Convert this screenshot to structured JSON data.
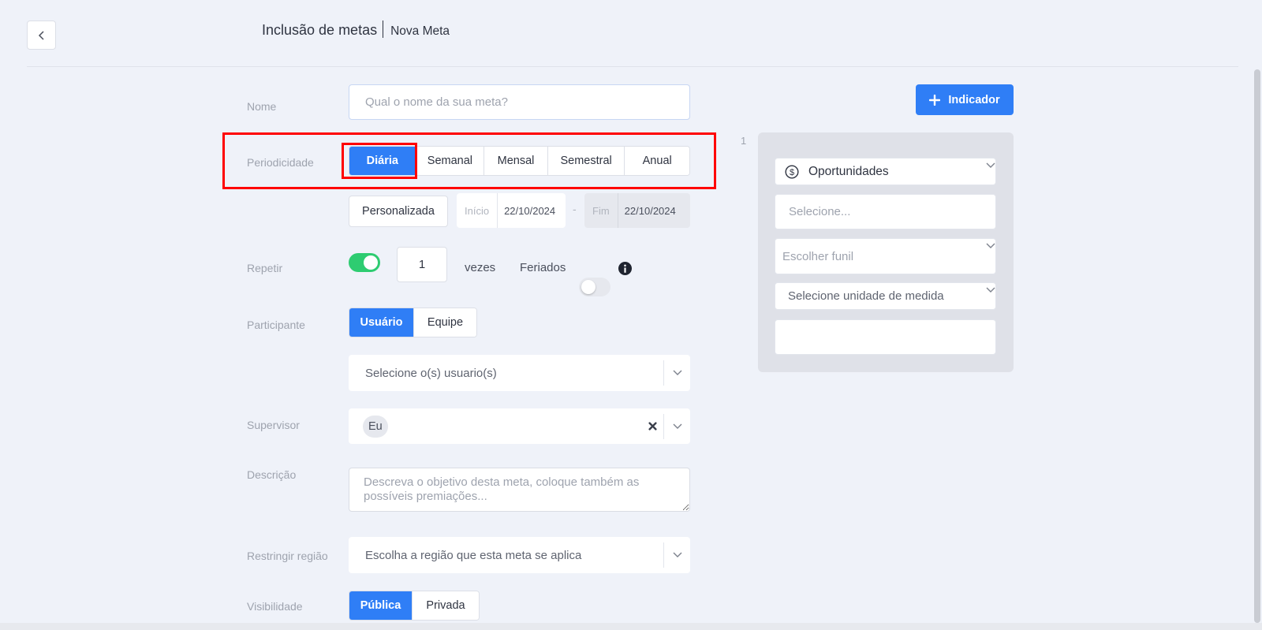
{
  "header": {
    "title": "Inclusão de metas",
    "subtitle": "Nova Meta"
  },
  "form": {
    "nome": {
      "label": "Nome",
      "placeholder": "Qual o nome da sua meta?"
    },
    "periodicidade": {
      "label": "Periodicidade",
      "options": [
        "Diária",
        "Semanal",
        "Mensal",
        "Semestral",
        "Anual"
      ],
      "selected": "Diária",
      "custom_label": "Personalizada",
      "inicio_label": "Início",
      "inicio_value": "22/10/2024",
      "range_sep": "-",
      "fim_label": "Fim",
      "fim_value": "22/10/2024"
    },
    "repetir": {
      "label": "Repetir",
      "count": "1",
      "vezes_label": "vezes",
      "feriados_label": "Feriados"
    },
    "participante": {
      "label": "Participante",
      "options": [
        "Usuário",
        "Equipe"
      ],
      "selected": "Usuário",
      "select_placeholder": "Selecione o(s) usuario(s)"
    },
    "supervisor": {
      "label": "Supervisor",
      "chip": "Eu"
    },
    "descricao": {
      "label": "Descrição",
      "placeholder": "Descreva o objetivo desta meta, coloque também as possíveis premiações..."
    },
    "regiao": {
      "label": "Restringir região",
      "placeholder": "Escolha a região que esta meta se aplica"
    },
    "visibilidade": {
      "label": "Visibilidade",
      "options": [
        "Pública",
        "Privada"
      ],
      "selected": "Pública"
    }
  },
  "indicator": {
    "add_label": "Indicador",
    "index": "1",
    "type": "Oportunidades",
    "select_placeholder": "Selecione...",
    "funnel_placeholder": "Escolher funil",
    "unit_placeholder": "Selecione unidade de medida"
  },
  "colors": {
    "primary": "#2f7ef6",
    "toggle_on": "#2ecc71",
    "highlight": "#ff0000"
  }
}
